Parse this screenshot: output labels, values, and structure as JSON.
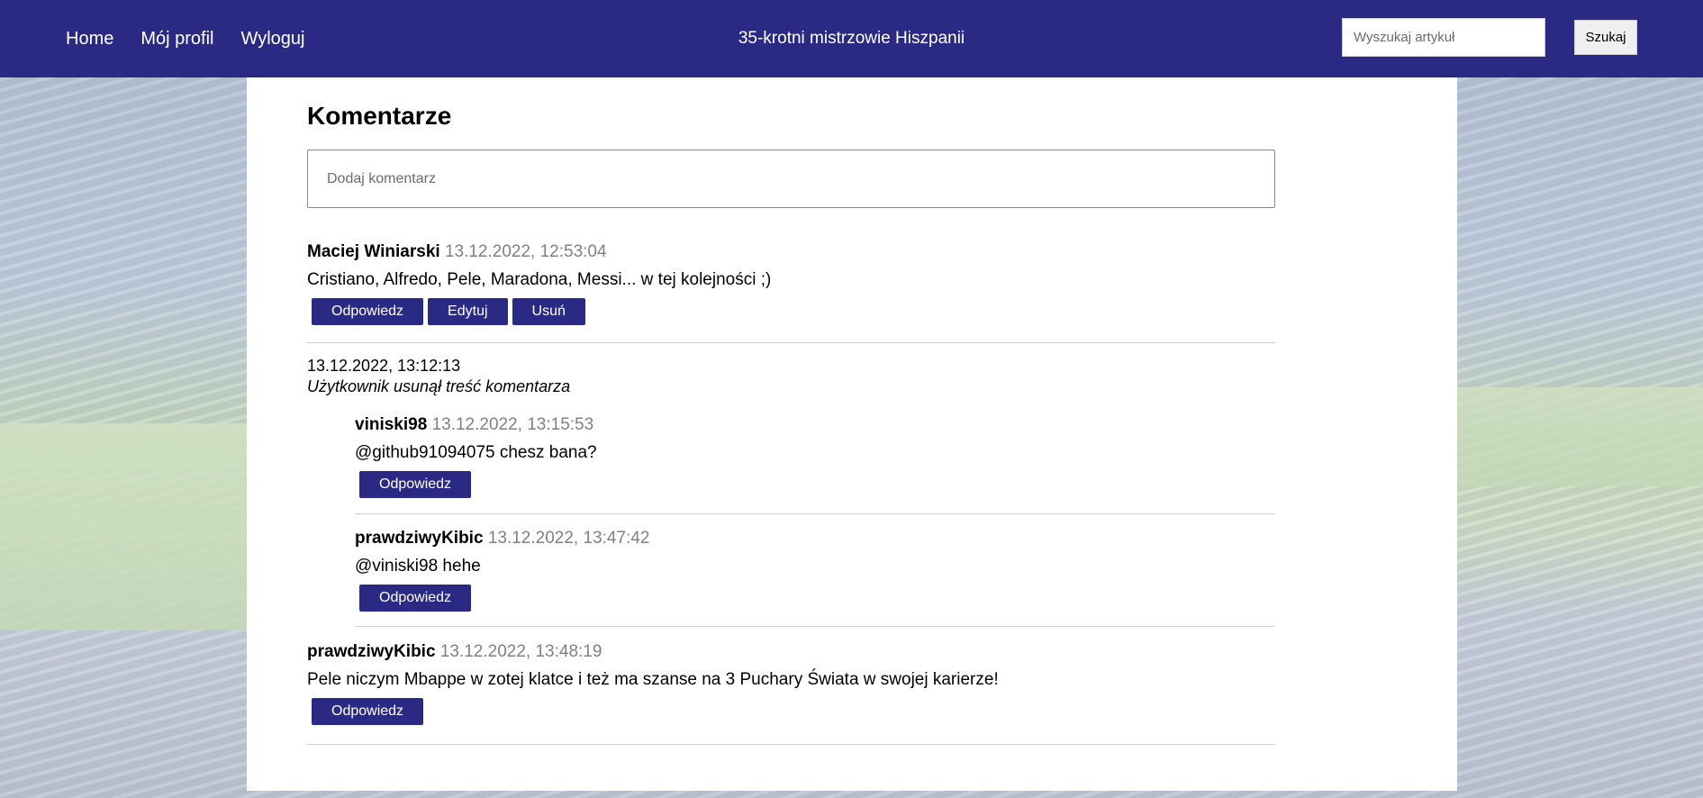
{
  "nav": {
    "links": [
      "Home",
      "Mój profil",
      "Wyloguj"
    ],
    "title": "35-krotni mistrzowie Hiszpanii",
    "search_placeholder": "Wyszukaj artykuł",
    "search_button": "Szukaj"
  },
  "comments_section": {
    "title": "Komentarze",
    "input_placeholder": "Dodaj komentarz"
  },
  "comments": [
    {
      "author": "Maciej Winiarski",
      "date": "13.12.2022, 12:53:04",
      "text": "Cristiano, Alfredo, Pele, Maradona, Messi... w tej kolejności ;)",
      "actions": [
        "Odpowiedz",
        "Edytuj",
        "Usuń"
      ]
    },
    {
      "date": "13.12.2022, 13:12:13",
      "deleted_text": "Użytkownik usunął treść komentarza",
      "replies": [
        {
          "author": "viniski98",
          "date": "13.12.2022, 13:15:53",
          "text": "@github91094075 chesz bana?",
          "actions": [
            "Odpowiedz"
          ]
        },
        {
          "author": "prawdziwyKibic",
          "date": "13.12.2022, 13:47:42",
          "text": "@viniski98 hehe",
          "actions": [
            "Odpowiedz"
          ]
        }
      ]
    },
    {
      "author": "prawdziwyKibic",
      "date": "13.12.2022, 13:48:19",
      "text": "Pele niczym Mbappe w zotej klatce i też ma szanse na 3 Puchary Świata w swojej karierze!",
      "actions": [
        "Odpowiedz"
      ]
    }
  ]
}
